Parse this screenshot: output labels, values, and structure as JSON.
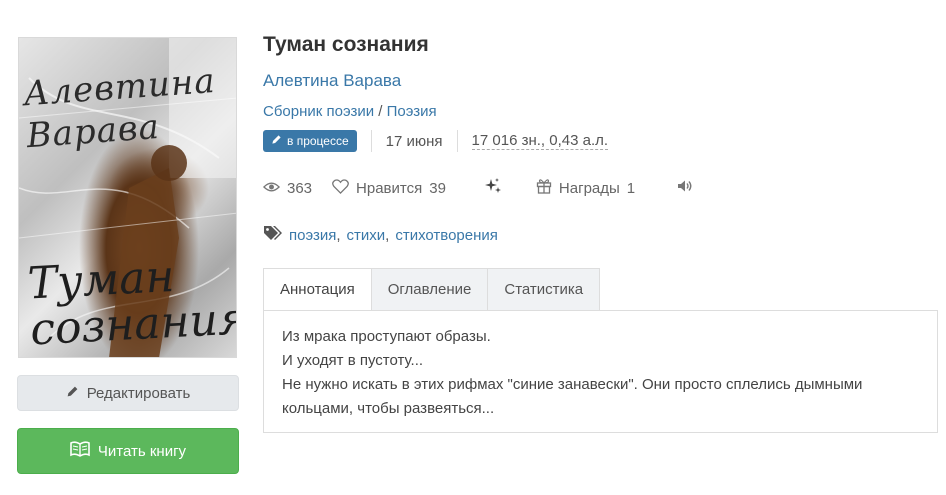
{
  "cover": {
    "author_text": "Алевтина Варава",
    "title_text": "Туман сознания"
  },
  "book": {
    "title": "Туман сознания",
    "author": "Алевтина Варава",
    "genre_primary": "Сборник поэзии",
    "genre_separator": "/",
    "genre_secondary": "Поэзия",
    "status_badge": "в процессе",
    "date": "17 июня",
    "size": "17 016 зн., 0,43 а.л."
  },
  "stats": {
    "views": "363",
    "likes_label": "Нравится",
    "likes_count": "39",
    "awards_label": "Награды",
    "awards_count": "1"
  },
  "tags": [
    "поэзия",
    "стихи",
    "стихотворения"
  ],
  "tags_separator": ",",
  "tabs": [
    {
      "label": "Аннотация",
      "active": true
    },
    {
      "label": "Оглавление",
      "active": false
    },
    {
      "label": "Статистика",
      "active": false
    }
  ],
  "annotation": [
    "Из мрака проступают образы.",
    "И уходят в пустоту...",
    "Не нужно искать в этих рифмах \"синие занавески\". Они просто сплелись дымными кольцами, чтобы развеяться..."
  ],
  "buttons": {
    "edit_label": "Редактировать",
    "read_label": "Читать книгу"
  },
  "colors": {
    "link": "#3a78a8",
    "badge_bg": "#3a78a8",
    "read_button": "#5cb85c",
    "edit_button": "#e6e9ec"
  },
  "icons": {
    "edit": "pencil-icon",
    "read": "book-open-icon",
    "views": "eye-icon",
    "likes": "heart-icon",
    "sparkle": "sparkles-icon",
    "awards": "gift-icon",
    "audio": "speaker-icon",
    "tags": "tags-icon",
    "status": "pencil-icon"
  }
}
